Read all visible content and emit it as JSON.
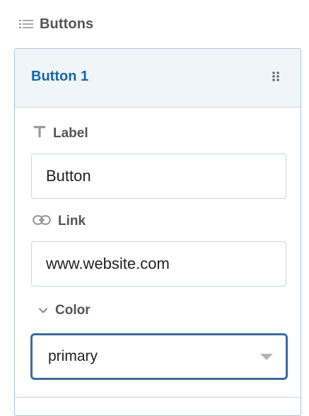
{
  "section": {
    "title": "Buttons",
    "icon": "list-icon"
  },
  "item": {
    "title": "Button 1",
    "drag_icon": "drag-handle-icon",
    "accent_color": "#1766a6"
  },
  "fields": {
    "label": {
      "label": "Label",
      "icon": "text-icon",
      "value": "Button"
    },
    "link": {
      "label": "Link",
      "icon": "link-icon",
      "value": "www.website.com"
    },
    "color": {
      "label": "Color",
      "icon": "chevron-down-icon",
      "selected": "primary"
    }
  }
}
